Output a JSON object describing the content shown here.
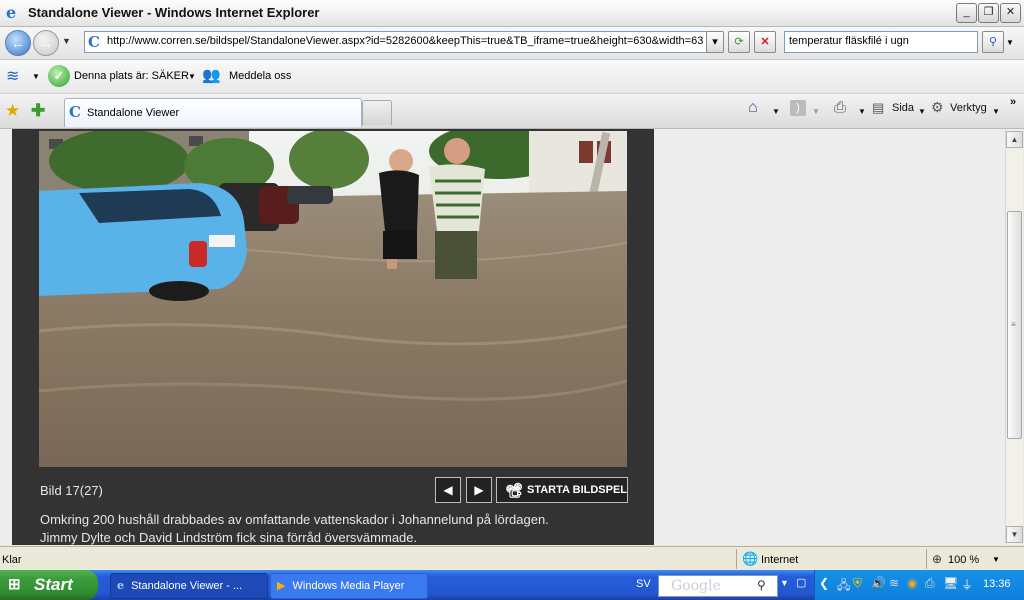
{
  "window": {
    "title": "Standalone Viewer - Windows Internet Explorer",
    "btn_minimize": "_",
    "btn_restore": "❐",
    "btn_close": "✕"
  },
  "address": {
    "url": "http://www.corren.se/bildspel/StandaloneViewer.aspx?id=5282600&keepThis=true&TB_iframe=true&height=630&width=63",
    "search_value": "temperatur fläskfilé i ugn"
  },
  "links": {
    "site_status": "Denna plats är: SÄKER",
    "report": "Meddela oss"
  },
  "tabs": [
    {
      "label": "Standalone Viewer"
    }
  ],
  "commands": {
    "page": "Sida",
    "tools": "Verktyg"
  },
  "viewer": {
    "counter": "Bild 17(27)",
    "slideshow": "STARTA BILDSPEL",
    "caption_line1": "Omkring 200 hushåll drabbades av omfattande vattenskador i Johannelund på lördagen.",
    "caption_line2": "Jimmy Dylte och David Lindström fick sina förråd översvämmade."
  },
  "status": {
    "text": "Klar",
    "zone": "Internet",
    "zoom": "100 %"
  },
  "taskbar": {
    "start": "Start",
    "items": [
      {
        "label": "Standalone Viewer - ..."
      },
      {
        "label": "Windows Media Player"
      }
    ],
    "language": "SV",
    "search_brand": "Google",
    "clock": "13:36"
  },
  "colors": {
    "panel_bg": "#333333",
    "taskbar": "#245edb",
    "start_green": "#3c9b3c"
  }
}
